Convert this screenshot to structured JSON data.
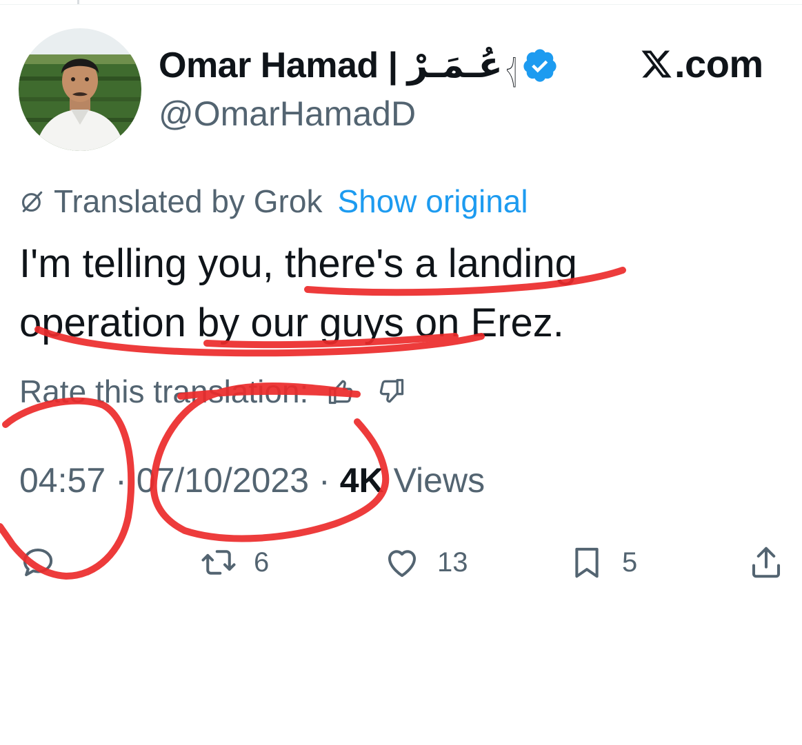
{
  "header": {
    "display_name": "Omar Hamad | عُـمَـرْ",
    "flag_glyph": "𓂆",
    "handle": "@OmarHamadD",
    "site_label": ".com"
  },
  "translation": {
    "translated_by": "Translated by Grok",
    "show_original": "Show original"
  },
  "tweet": {
    "text": "I'm telling you, there's a landing operation by our guys on Erez."
  },
  "rate": {
    "label": "Rate this translation:"
  },
  "meta": {
    "time": "04:57",
    "separator": "·",
    "date": "07/10/2023",
    "views_count": "4K",
    "views_label": "Views"
  },
  "actions": {
    "retweets": "6",
    "likes": "13",
    "bookmarks": "5"
  },
  "colors": {
    "text_primary": "#0f1419",
    "text_secondary": "#536471",
    "link": "#1d9bf0",
    "verified": "#1d9bf0",
    "annotation": "#ec2b2b"
  },
  "icons": {
    "verified": "verified-badge-icon",
    "translate": "translate-icon",
    "thumbs_up": "thumbs-up-icon",
    "thumbs_down": "thumbs-down-icon",
    "reply": "reply-icon",
    "retweet": "retweet-icon",
    "like": "heart-icon",
    "bookmark": "bookmark-icon",
    "share": "share-icon",
    "x_logo": "x-logo-icon"
  }
}
